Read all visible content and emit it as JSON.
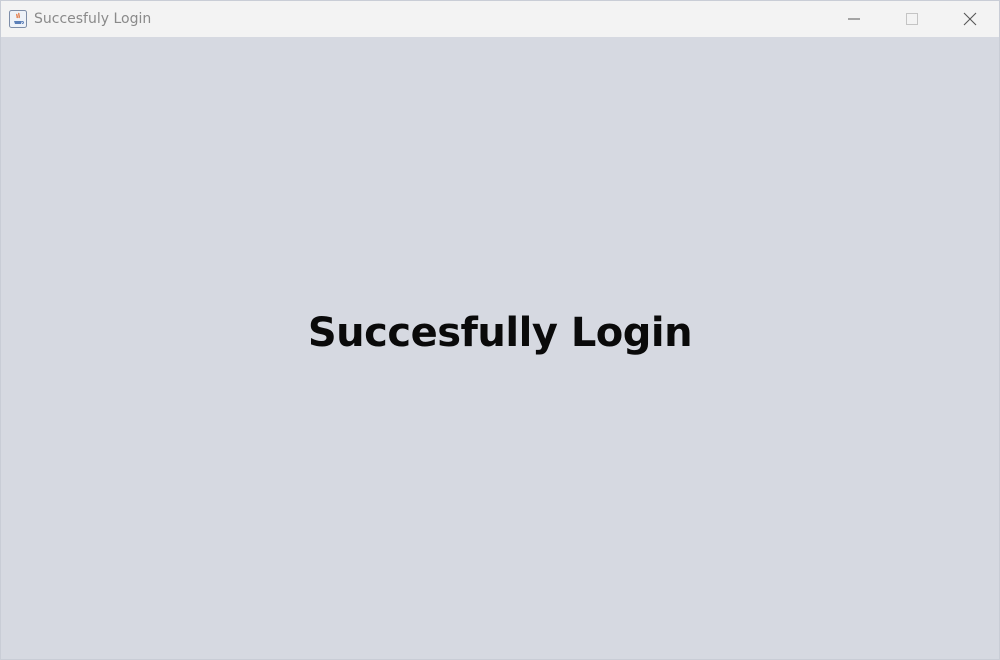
{
  "window": {
    "title": "Succesfuly Login",
    "icon": "java-icon",
    "controls": {
      "minimize_icon": "minimize-icon",
      "maximize_icon": "maximize-icon",
      "close_icon": "close-icon"
    }
  },
  "main": {
    "message": "Succesfully Login"
  },
  "colors": {
    "titlebar_bg": "#f3f3f3",
    "content_bg": "#d6d9e1",
    "message_text": "#0a0a0a",
    "title_text": "#8a8a8a"
  }
}
